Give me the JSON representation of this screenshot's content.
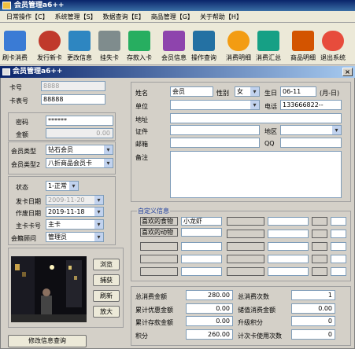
{
  "app": {
    "title": "会员管理a6++"
  },
  "menu": [
    {
      "label": "日常操作【C】"
    },
    {
      "label": "系统管理【S】"
    },
    {
      "label": "数据查询【E】"
    },
    {
      "label": "商品管理【G】"
    },
    {
      "label": "关于帮助【H】"
    }
  ],
  "toolbar": [
    {
      "label": "刷卡消费",
      "icon": "pos-icon",
      "color": "#3a7bd5"
    },
    {
      "label": "发行新卡",
      "icon": "new-card-icon",
      "color": "#c0392b"
    },
    {
      "label": "更改信息",
      "icon": "edit-info-icon",
      "color": "#2e86c1"
    },
    {
      "label": "挂失卡",
      "icon": "lost-card-icon",
      "color": "#7f8c8d"
    },
    {
      "label": "存款入卡",
      "icon": "deposit-icon",
      "color": "#27ae60"
    },
    {
      "label": "会员信息",
      "icon": "members-icon",
      "color": "#8e44ad"
    },
    {
      "label": "操作查询",
      "icon": "query-icon",
      "color": "#2471a3"
    },
    {
      "label": "消费明细",
      "icon": "consume-detail-icon",
      "color": "#f39c12"
    },
    {
      "label": "消费汇总",
      "icon": "consume-summary-icon",
      "color": "#16a085"
    },
    {
      "label": "商品明细",
      "icon": "goods-detail-icon",
      "color": "#d35400"
    },
    {
      "label": "退出系统",
      "icon": "exit-icon",
      "color": "#e74c3c"
    }
  ],
  "dialog": {
    "title": "会员管理a6++",
    "close": "×"
  },
  "card": {
    "card_no_label": "卡号",
    "card_no_value": "8888",
    "card_face_label": "卡表号",
    "card_face_value": "88888"
  },
  "account": {
    "password_label": "密码",
    "password_value": "******",
    "balance_label": "金额",
    "balance_value": "0.00"
  },
  "membership": {
    "type_label": "会员类型",
    "type_value": "钻石会员",
    "type2_label": "会员类型2",
    "type2_value": "八折商品会员卡"
  },
  "status": {
    "status_label": "状态",
    "status_value": "1-正常",
    "issue_date_label": "发卡日期",
    "issue_date_value": "2009-11-20",
    "op_date_label": "作废日期",
    "op_date_value": "2019-11-18",
    "main_card_label": "主卡卡号",
    "main_card_value": "主卡",
    "consultant_label": "会籍顾问",
    "consultant_value": "管理员"
  },
  "photo_buttons": {
    "browse": "浏览",
    "capture": "捕获",
    "refresh": "刷新",
    "zoom": "放大"
  },
  "modify_button": "修改信息查询",
  "profile": {
    "name_label": "姓名",
    "name_value": "会员",
    "gender_label": "性别",
    "gender_value": "女",
    "birthday_label": "生日",
    "birthday_value": "06-11",
    "birthday_hint": "(月-日)",
    "unit_label": "单位",
    "unit_value": "",
    "phone_label": "电话",
    "phone_value": "133666822--",
    "address_label": "地址",
    "address_value": "",
    "id_label": "证件",
    "id_value": "",
    "region_label": "地区",
    "region_value": "",
    "email_label": "邮箱",
    "email_value": "",
    "qq_label": "QQ",
    "qq_value": "",
    "remark_label": "备注",
    "remark_value": ""
  },
  "custom": {
    "title": "自定义信息",
    "rows": [
      {
        "k": "喜欢的食物",
        "v": "小龙虾"
      },
      {
        "k": "喜欢的动物",
        "v": ""
      },
      {
        "k": "",
        "v": ""
      },
      {
        "k": "",
        "v": ""
      },
      {
        "k": "",
        "v": ""
      }
    ]
  },
  "stats": {
    "total_consume_label": "总消费金额",
    "total_consume_value": "280.00",
    "total_count_label": "总消费次数",
    "total_count_value": "1",
    "discount_label": "累计优惠金额",
    "discount_value": "0.00",
    "stored_label": "储值消费金额",
    "stored_value": "0.00",
    "deposit_label": "累计存款金额",
    "deposit_value": "0.00",
    "upgrade_label": "升级积分",
    "upgrade_value": "0",
    "points_label": "积分",
    "points_value": "260.00",
    "count_card_label": "计次卡使用次数",
    "count_card_value": "0"
  }
}
